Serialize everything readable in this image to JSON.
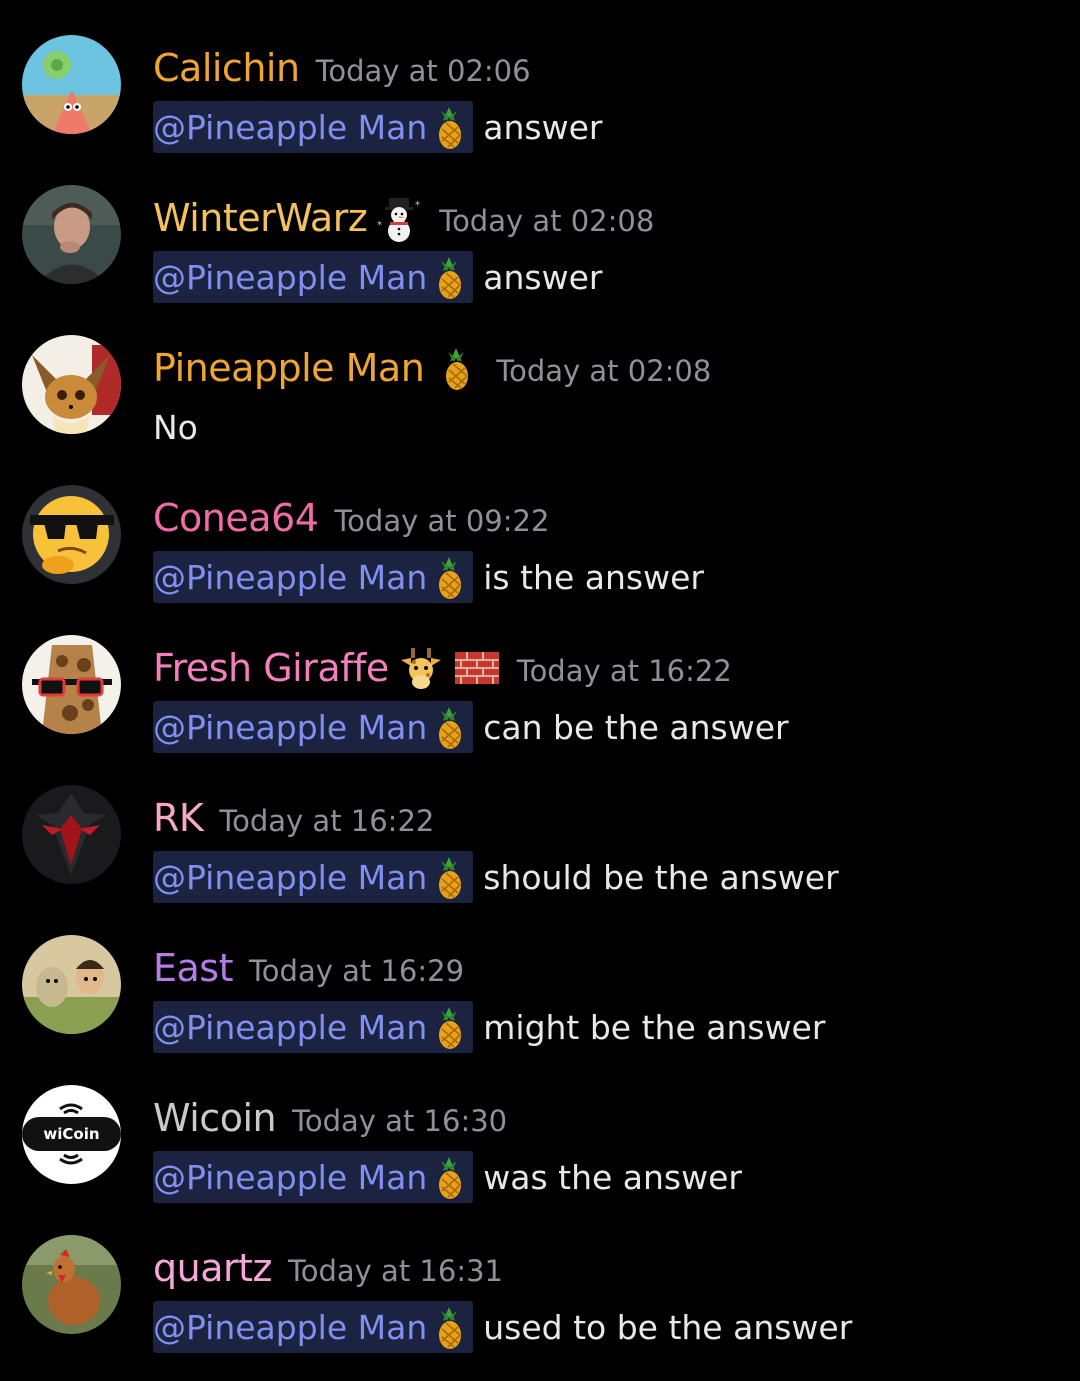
{
  "colors": {
    "background": "#000000",
    "timestamp": "#8e9297",
    "message_text": "#e8e8e8",
    "mention_text": "#7f90f0",
    "mention_bg": "#1c2340"
  },
  "mention_label": "@Pineapple Man",
  "messages": [
    {
      "username": "Calichin",
      "username_color": "#f0a431",
      "timestamp": "Today at 02:06",
      "mention": true,
      "text": "answer",
      "avatar_icon": "starfish-cartoon-avatar",
      "badges": []
    },
    {
      "username": "WinterWarz",
      "username_color": "#f5c15c",
      "timestamp": "Today at 02:08",
      "mention": true,
      "text": "answer",
      "avatar_icon": "person-photo-avatar",
      "badges": [
        "snowman-icon"
      ]
    },
    {
      "username": "Pineapple Man",
      "username_color": "#f0a431",
      "timestamp": "Today at 02:08",
      "mention": false,
      "text": "No",
      "avatar_icon": "fox-creature-avatar",
      "badges": [
        "pineapple-icon"
      ]
    },
    {
      "username": "Conea64",
      "username_color": "#f06ba8",
      "timestamp": "Today at 09:22",
      "mention": true,
      "text": "is the answer",
      "avatar_icon": "thinking-sunglasses-emoji-avatar",
      "badges": []
    },
    {
      "username": "Fresh Giraffe",
      "username_color": "#f47fbf",
      "timestamp": "Today at 16:22",
      "mention": true,
      "text": "can be the answer",
      "avatar_icon": "giraffe-sunglasses-avatar",
      "badges": [
        "giraffe-icon",
        "brick-icon"
      ]
    },
    {
      "username": "RK",
      "username_color": "#f7a8c8",
      "timestamp": "Today at 16:22",
      "mention": true,
      "text": "should be the answer",
      "avatar_icon": "dark-red-emblem-avatar",
      "badges": []
    },
    {
      "username": "East",
      "username_color": "#b57be8",
      "timestamp": "Today at 16:29",
      "mention": true,
      "text": "might be the answer",
      "avatar_icon": "cartoon-characters-avatar",
      "badges": []
    },
    {
      "username": "Wicoin",
      "username_color": "#c9c9c9",
      "timestamp": "Today at 16:30",
      "mention": true,
      "text": "was the answer",
      "avatar_icon": "wicoin-logo-avatar",
      "avatar_logo_text": "wiCoin",
      "badges": []
    },
    {
      "username": "quartz",
      "username_color": "#f5a8d8",
      "timestamp": "Today at 16:31",
      "mention": true,
      "text": "used to be the answer",
      "avatar_icon": "chicken-photo-avatar",
      "badges": []
    }
  ]
}
